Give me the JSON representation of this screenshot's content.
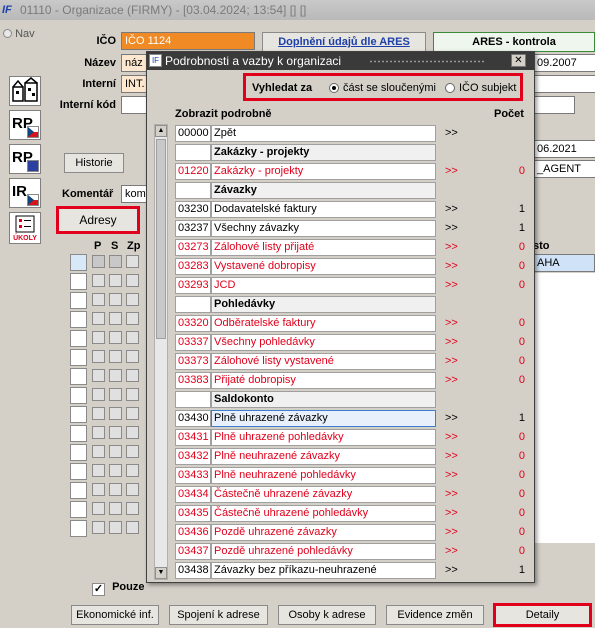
{
  "window": {
    "title": "01110 - Organizace (FIRMY) - [03.04.2024; 13:54]  []  []",
    "logo": "IF"
  },
  "nav": {
    "label": "Nav"
  },
  "side_buttons": [
    {
      "name": "buildings-icon",
      "label": ""
    },
    {
      "name": "rp-cz-icon",
      "label": "RP"
    },
    {
      "name": "rp-eu-icon",
      "label": "RP"
    },
    {
      "name": "ir-cz-icon",
      "label": "IR"
    },
    {
      "name": "ukoly-icon",
      "label": "ÚKOLY"
    }
  ],
  "form": {
    "ico_label": "IČO",
    "ico_value": "IČO 1124",
    "ares_fill_button": "Doplnění údajů dle ARES",
    "ares_check_button": "ARES - kontrola",
    "nazev_label": "Název",
    "nazev_value": "náz",
    "date1": "09.2007",
    "interni_label": "Interní",
    "interni_value": "INT.",
    "interni_kod_label": "Interní kód",
    "date2": "06.2021",
    "agent_value": "_AGENT",
    "historie_button": "Historie",
    "komentar_label": "Komentář",
    "komentar_value": "kom",
    "adresy_button": "Adresy",
    "col_p": "P",
    "col_s": "S",
    "col_zp": "Zp",
    "col_sto": "sto",
    "aha_value": "AHA",
    "pouze_label": "Pouze"
  },
  "bottom_buttons": [
    "Ekonomické inf.",
    "Spojení k adrese",
    "Osoby k adrese",
    "Evidence změn",
    "Detaily"
  ],
  "dialog": {
    "title": "Podrobnosti a vazby k organizaci",
    "search_label": "Vyhledat za",
    "radio_options": [
      {
        "label": "část se sloučenými",
        "selected": true
      },
      {
        "label": "IČO subjekt",
        "selected": false
      }
    ],
    "col_detail": "Zobrazit podrobně",
    "col_count": "Počet",
    "rows": [
      {
        "code": "00000",
        "name": "Zpět",
        "arrow": ">>",
        "count": "",
        "type": "normal"
      },
      {
        "code": "",
        "name": "Zakázky - projekty",
        "arrow": "",
        "count": "",
        "type": "hdr"
      },
      {
        "code": "01220",
        "name": "Zakázky - projekty",
        "arrow": ">>",
        "count": "0",
        "type": "red"
      },
      {
        "code": "",
        "name": "Závazky",
        "arrow": "",
        "count": "",
        "type": "hdr"
      },
      {
        "code": "03230",
        "name": "Dodavatelské faktury",
        "arrow": ">>",
        "count": "1",
        "type": "normal"
      },
      {
        "code": "03237",
        "name": "Všechny závazky",
        "arrow": ">>",
        "count": "1",
        "type": "normal"
      },
      {
        "code": "03273",
        "name": "Zálohové listy přijaté",
        "arrow": ">>",
        "count": "0",
        "type": "red"
      },
      {
        "code": "03283",
        "name": "Vystavené dobropisy",
        "arrow": ">>",
        "count": "0",
        "type": "red"
      },
      {
        "code": "03293",
        "name": "JCD",
        "arrow": ">>",
        "count": "0",
        "type": "red"
      },
      {
        "code": "",
        "name": "Pohledávky",
        "arrow": "",
        "count": "",
        "type": "hdr"
      },
      {
        "code": "03320",
        "name": "Odběratelské faktury",
        "arrow": ">>",
        "count": "0",
        "type": "red"
      },
      {
        "code": "03337",
        "name": "Všechny pohledávky",
        "arrow": ">>",
        "count": "0",
        "type": "red"
      },
      {
        "code": "03373",
        "name": "Zálohové listy vystavené",
        "arrow": ">>",
        "count": "0",
        "type": "red"
      },
      {
        "code": "03383",
        "name": "Přijaté dobropisy",
        "arrow": ">>",
        "count": "0",
        "type": "red"
      },
      {
        "code": "",
        "name": "Saldokonto",
        "arrow": "",
        "count": "",
        "type": "hdr"
      },
      {
        "code": "03430",
        "name": "Plně uhrazené závazky",
        "arrow": ">>",
        "count": "1",
        "type": "sel"
      },
      {
        "code": "03431",
        "name": "Plně uhrazené pohledávky",
        "arrow": ">>",
        "count": "0",
        "type": "red"
      },
      {
        "code": "03432",
        "name": "Plně neuhrazené závazky",
        "arrow": ">>",
        "count": "0",
        "type": "red"
      },
      {
        "code": "03433",
        "name": "Plně neuhrazené pohledávky",
        "arrow": ">>",
        "count": "0",
        "type": "red"
      },
      {
        "code": "03434",
        "name": "Částečně uhrazené závazky",
        "arrow": ">>",
        "count": "0",
        "type": "red"
      },
      {
        "code": "03435",
        "name": "Částečně uhrazené pohledávky",
        "arrow": ">>",
        "count": "0",
        "type": "red"
      },
      {
        "code": "03436",
        "name": "Pozdě uhrazené závazky",
        "arrow": ">>",
        "count": "0",
        "type": "red"
      },
      {
        "code": "03437",
        "name": "Pozdě uhrazené pohledávky",
        "arrow": ">>",
        "count": "0",
        "type": "red"
      },
      {
        "code": "03438",
        "name": "Závazky bez příkazu-neuhrazené",
        "arrow": ">>",
        "count": "1",
        "type": "normal"
      }
    ]
  },
  "colors": {
    "highlight_red": "#e0001b",
    "ico_orange": "#f08a24",
    "ares_green": "#3a8a3a"
  }
}
